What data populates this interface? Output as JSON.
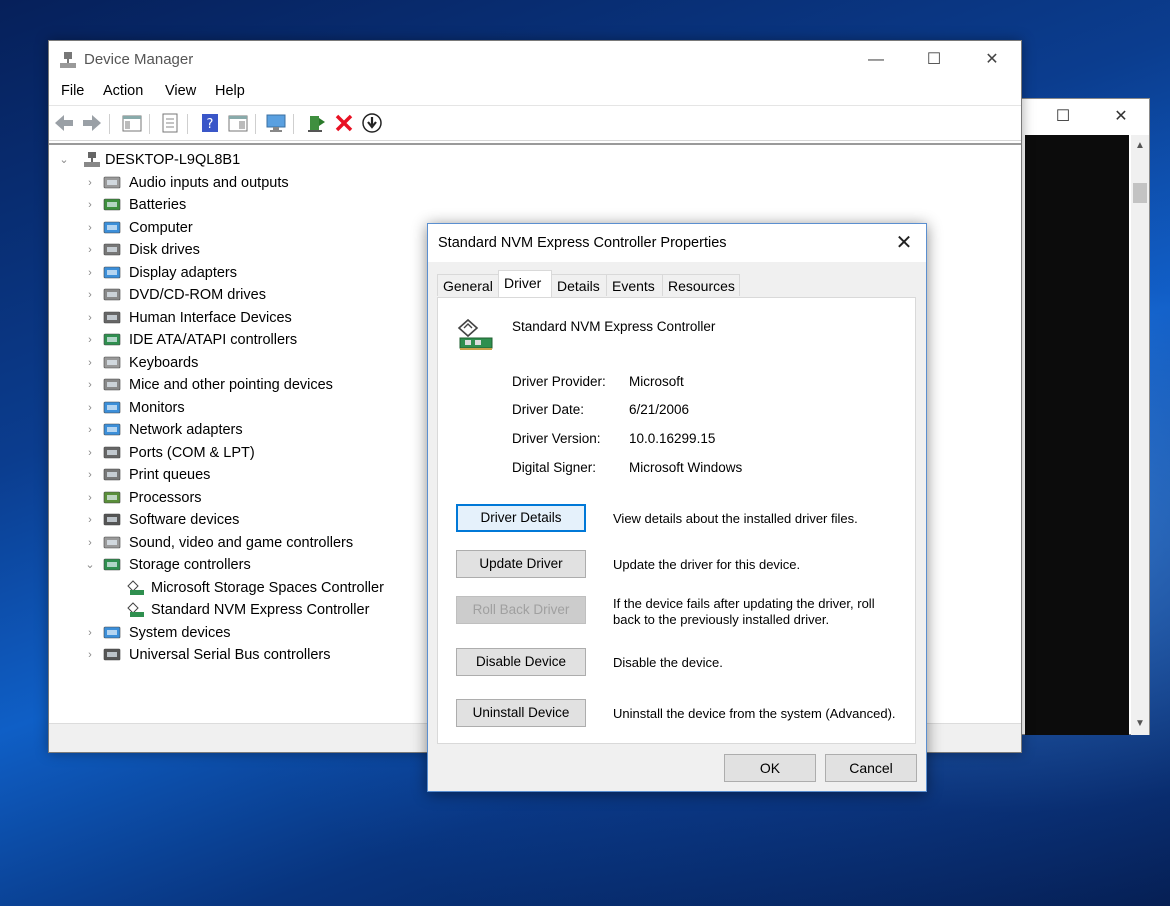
{
  "device_manager": {
    "title": "Device Manager",
    "menu": [
      "File",
      "Action",
      "View",
      "Help"
    ],
    "computer_name": "DESKTOP-L9QL8B1",
    "categories": [
      {
        "label": "Audio inputs and outputs",
        "icon": "speaker-icon"
      },
      {
        "label": "Batteries",
        "icon": "battery-icon"
      },
      {
        "label": "Computer",
        "icon": "computer-icon"
      },
      {
        "label": "Disk drives",
        "icon": "disk-drive-icon"
      },
      {
        "label": "Display adapters",
        "icon": "display-adapter-icon"
      },
      {
        "label": "DVD/CD-ROM drives",
        "icon": "dvd-drive-icon"
      },
      {
        "label": "Human Interface Devices",
        "icon": "hid-icon"
      },
      {
        "label": "IDE ATA/ATAPI controllers",
        "icon": "ide-controller-icon"
      },
      {
        "label": "Keyboards",
        "icon": "keyboard-icon"
      },
      {
        "label": "Mice and other pointing devices",
        "icon": "mouse-icon"
      },
      {
        "label": "Monitors",
        "icon": "monitor-icon"
      },
      {
        "label": "Network adapters",
        "icon": "network-adapter-icon"
      },
      {
        "label": "Ports (COM & LPT)",
        "icon": "port-icon"
      },
      {
        "label": "Print queues",
        "icon": "printer-icon"
      },
      {
        "label": "Processors",
        "icon": "processor-icon"
      },
      {
        "label": "Software devices",
        "icon": "software-device-icon"
      },
      {
        "label": "Sound, video and game controllers",
        "icon": "sound-icon"
      },
      {
        "label": "Storage controllers",
        "icon": "storage-controller-icon"
      },
      {
        "label": "System devices",
        "icon": "system-device-icon"
      },
      {
        "label": "Universal Serial Bus controllers",
        "icon": "usb-icon"
      }
    ],
    "storage_children": [
      "Microsoft Storage Spaces Controller",
      "Standard NVM Express Controller"
    ]
  },
  "dialog": {
    "title": "Standard NVM Express Controller Properties",
    "tabs": [
      "General",
      "Driver",
      "Details",
      "Events",
      "Resources"
    ],
    "active_tab": "Driver",
    "device_name": "Standard NVM Express Controller",
    "info": {
      "provider_label": "Driver Provider:",
      "provider_value": "Microsoft",
      "date_label": "Driver Date:",
      "date_value": "6/21/2006",
      "version_label": "Driver Version:",
      "version_value": "10.0.16299.15",
      "signer_label": "Digital Signer:",
      "signer_value": "Microsoft Windows"
    },
    "actions": {
      "details_label": "Driver Details",
      "details_desc": "View details about the installed driver files.",
      "update_label": "Update Driver",
      "update_desc": "Update the driver for this device.",
      "rollback_label": "Roll Back Driver",
      "rollback_desc": "If the device fails after updating the driver, roll back to the previously installed driver.",
      "disable_label": "Disable Device",
      "disable_desc": "Disable the device.",
      "uninstall_label": "Uninstall Device",
      "uninstall_desc": "Uninstall the device from the system (Advanced)."
    },
    "ok_label": "OK",
    "cancel_label": "Cancel"
  },
  "colors": {
    "accent": "#0078d7",
    "delete_red": "#e81123"
  }
}
